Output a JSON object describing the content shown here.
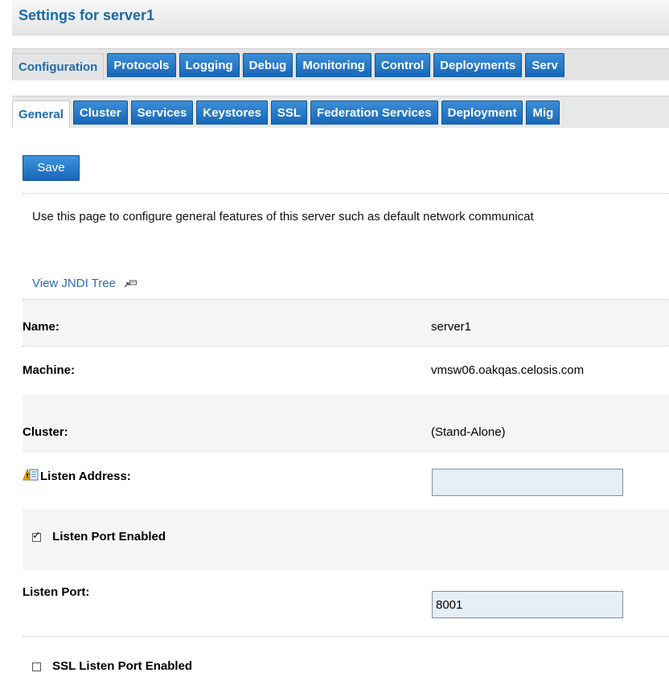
{
  "page_title": "Settings for server1",
  "primary_tabs": [
    {
      "label": "Configuration",
      "active": true
    },
    {
      "label": "Protocols",
      "active": false
    },
    {
      "label": "Logging",
      "active": false
    },
    {
      "label": "Debug",
      "active": false
    },
    {
      "label": "Monitoring",
      "active": false
    },
    {
      "label": "Control",
      "active": false
    },
    {
      "label": "Deployments",
      "active": false
    },
    {
      "label": "Serv",
      "active": false
    }
  ],
  "secondary_tabs": [
    {
      "label": "General",
      "active": true
    },
    {
      "label": "Cluster",
      "active": false
    },
    {
      "label": "Services",
      "active": false
    },
    {
      "label": "Keystores",
      "active": false
    },
    {
      "label": "SSL",
      "active": false
    },
    {
      "label": "Federation Services",
      "active": false
    },
    {
      "label": "Deployment",
      "active": false
    },
    {
      "label": "Mig",
      "active": false
    }
  ],
  "toolbar": {
    "save_label": "Save"
  },
  "description": "Use this page to configure general features of this server such as default network communicat",
  "jndi_link": "View JNDI Tree",
  "fields": {
    "name": {
      "label": "Name:",
      "value": "server1"
    },
    "machine": {
      "label": "Machine:",
      "value": "vmsw06.oakqas.celosis.com"
    },
    "cluster": {
      "label": "Cluster:",
      "value": "(Stand-Alone)"
    },
    "listen_address": {
      "label": "Listen Address:",
      "value": ""
    },
    "listen_port_enabled": {
      "label": "Listen Port Enabled",
      "checked": true
    },
    "listen_port": {
      "label": "Listen Port:",
      "value": "8001"
    },
    "ssl_listen_port_enabled": {
      "label": "SSL Listen Port Enabled",
      "checked": false
    }
  },
  "colors": {
    "accent": "#1766b7",
    "title": "#1a6aa8",
    "link": "#2a6cb6",
    "input_bg": "#e6eef8"
  },
  "icons": {
    "external_link": "external-link-icon",
    "warning_help": "warning-help-icon"
  }
}
